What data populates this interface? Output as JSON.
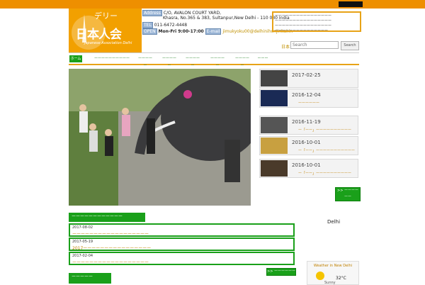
{
  "logo": {
    "top": "デリー",
    "main": "日本人会",
    "sub": "Japanese Association Delhi"
  },
  "contact": {
    "address_tag": "Address",
    "address_line1": "C/O, AVALON COURT YARD,",
    "address_line2": "Khasra, No.365 & 383, Sultanpur,New Delhi - 110 030 India",
    "tel_tag": "TEL",
    "tel": "011-6472-4448",
    "open_tag": "OPEN",
    "hours": "Mon-Fri 9:00-17:00",
    "email_tag": "E-mail",
    "email": "jimukyoku00@delhinihonjinkai.in"
  },
  "notice_box": {
    "lines": [
      "ーーーーーーーーーーーーーーーー",
      "ーーーーーーーーーーーーーーーー",
      "ーーーーーーーーーーーーーーーー",
      "ーーーーーーーーーーーーーーー"
    ]
  },
  "lang": "日本",
  "search": {
    "placeholder": "Search",
    "button": "Search"
  },
  "nav": {
    "items": [
      "ホーム",
      "ーーーーーーーーーー",
      "ーーーーー",
      "ーーーーー",
      "ーーーーー",
      "ーーーーー",
      "ーーーーー",
      "ーーー"
    ]
  },
  "news": {
    "items": [
      {
        "date": "2017-02-25",
        "title": ""
      },
      {
        "date": "2016-12-04",
        "title": "ーーーーーー"
      },
      {
        "date": "2016-11-19",
        "title": "ー「ーー」ーーーーーーーーーー"
      },
      {
        "date": "2016-10-01",
        "title": "ー「ーー」ーーーーーーーーーーー"
      },
      {
        "date": "2016-10-01",
        "title": "ー「ーー」ーーーーーーーーーー"
      }
    ],
    "more": ">> ーーーーーー"
  },
  "info_section": {
    "heading": "ーーーーーーーーーーーー",
    "items": [
      {
        "date": "2017-08-02",
        "title": "ーーーーーーーーーーーーーーーーーー"
      },
      {
        "date": "2017-05-19",
        "title": "2017ーーーーーーーーーーーーーーーー"
      },
      {
        "date": "2017-02-04",
        "title": "ーーーーーーーーーーーーーーーーーー"
      }
    ],
    "more": ">> ーーーーーー"
  },
  "second_heading": "ーーーーー",
  "weather": {
    "city": "Delhi",
    "title": "Weather in New Delhi",
    "temp": "32°C",
    "cond": "Sunny"
  }
}
